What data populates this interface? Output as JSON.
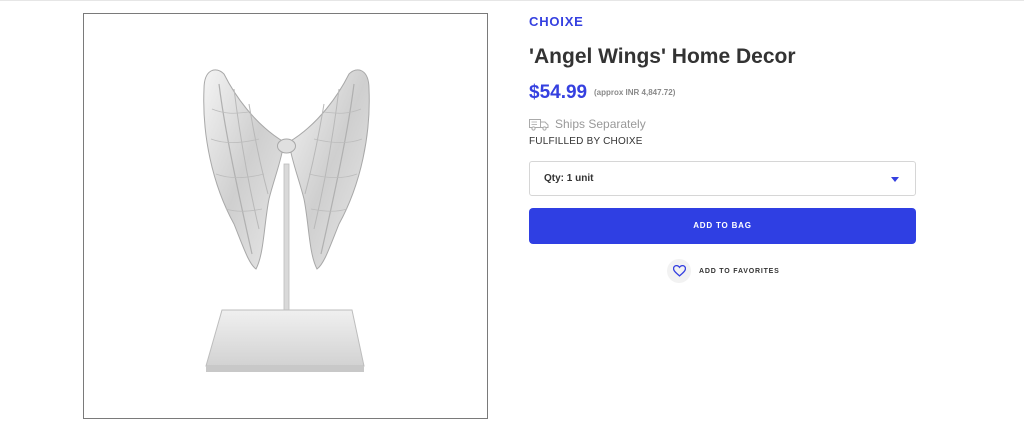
{
  "product": {
    "brand": "CHOIXE",
    "title": "'Angel Wings' Home Decor",
    "price": "$54.99",
    "approx_price": "(approx INR 4,847.72)",
    "shipping_text": "Ships Separately",
    "fulfilled_by": "FULFILLED BY CHOIXE"
  },
  "quantity": {
    "selected": "Qty: 1 unit"
  },
  "actions": {
    "add_to_bag": "ADD TO BAG",
    "add_to_favorites": "ADD TO FAVORITES"
  },
  "icons": {
    "truck": "truck-icon",
    "heart": "heart-icon",
    "caret": "chevron-down-icon"
  },
  "colors": {
    "accent": "#2f3fe3",
    "brand_text": "#3540e0"
  }
}
